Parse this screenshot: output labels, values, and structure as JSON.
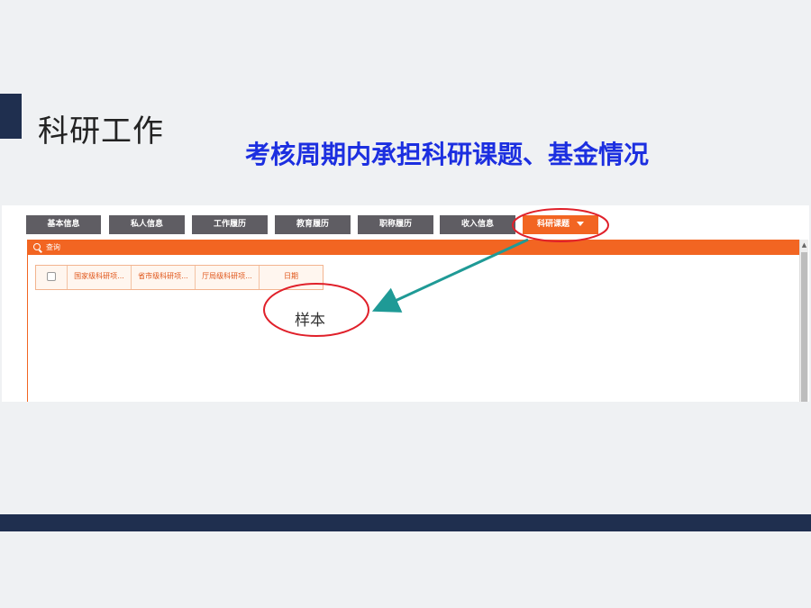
{
  "slide": {
    "title": "科研工作",
    "subtitle": "考核周期内承担科研课题、基金情况"
  },
  "tabs": [
    {
      "label": "基本信息",
      "active": false
    },
    {
      "label": "私人信息",
      "active": false
    },
    {
      "label": "工作履历",
      "active": false
    },
    {
      "label": "教育履历",
      "active": false
    },
    {
      "label": "职称履历",
      "active": false
    },
    {
      "label": "收入信息",
      "active": false
    },
    {
      "label": "科研课题",
      "active": true
    }
  ],
  "panel": {
    "header_label": "查询",
    "columns": [
      "国家级科研项...",
      "省市级科研项...",
      "厅局级科研项...",
      "日期"
    ]
  },
  "annotation": {
    "sample_label": "样本"
  },
  "colors": {
    "accent_orange": "#f26522",
    "tab_gray": "#5f5d63",
    "navy": "#1f2f4f",
    "subtitle_blue": "#1c2fe0",
    "annotation_red": "#e0202a",
    "arrow_teal": "#1f9a96"
  },
  "icons": {
    "search": "search-icon",
    "dropdown": "caret-down-icon"
  }
}
